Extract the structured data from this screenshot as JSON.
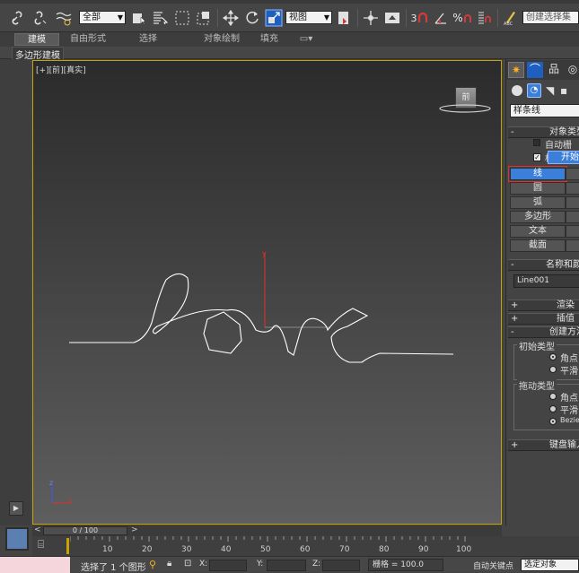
{
  "toolbar": {
    "selection_filter": "全部",
    "reference_coord": "视图",
    "named_selection_placeholder": "创建选择集",
    "snap_angle_label": "3",
    "percent_snap_label": "%",
    "icons": [
      "link-icon",
      "unlink-icon",
      "bind-spacewarp-icon",
      "select-object-icon",
      "select-by-name-icon",
      "rect-region-icon",
      "window-crossing-icon",
      "move-icon",
      "rotate-icon",
      "scale-icon",
      "pivot-icon",
      "select-manipulate-icon",
      "keyboard-shortcut-icon",
      "snap-toggle-icon",
      "angle-snap-icon",
      "percent-snap-icon",
      "spinner-snap-icon",
      "edit-named-selection-icon"
    ]
  },
  "ribbon": {
    "tabs": [
      "建模",
      "自由形式",
      "选择",
      "对象绘制",
      "填充"
    ],
    "active_tab": "建模",
    "sub_label": "多边形建模"
  },
  "viewport": {
    "label": "[+][前][真实]",
    "viewcube_label": "前",
    "axis_y": "y",
    "axis_z": "z",
    "axis_x": "x",
    "spline_text": "love"
  },
  "command_panel": {
    "category_dropdown": "样条线",
    "rollout_object_type": "对象类型",
    "auto_grid_label": "自动栅格",
    "start_new_shape": "开始新",
    "buttons": [
      "线",
      "圆",
      "弧",
      "多边形",
      "文本",
      "截面"
    ],
    "highlighted_button": "线",
    "rollout_name_color": "名称和颜",
    "object_name": "Line001",
    "rollout_render": "渲染",
    "rollout_interp": "插值",
    "rollout_create_method": "创建方法",
    "initial_type_label": "初始类型",
    "initial_options": [
      "角点",
      "平滑"
    ],
    "drag_type_label": "拖动类型",
    "drag_options": [
      "角点",
      "平滑",
      "Bezier"
    ],
    "rollout_keyboard": "键盘输入"
  },
  "timeline": {
    "frame_counter": "0 / 100",
    "ticks": [
      "10",
      "20",
      "30",
      "40",
      "50",
      "60",
      "70",
      "80",
      "90",
      "100"
    ]
  },
  "status": {
    "selection_text": "选择了 1 个图形",
    "x_label": "X:",
    "y_label": "Y:",
    "z_label": "Z:",
    "grid_text": "栅格 = 100.0",
    "auto_key": "自动关键点",
    "selected_obj": "选定对象"
  },
  "colors": {
    "viewport_border": "#c9a100",
    "highlight_red": "#e03030",
    "active_blue": "#3c7fd9"
  }
}
